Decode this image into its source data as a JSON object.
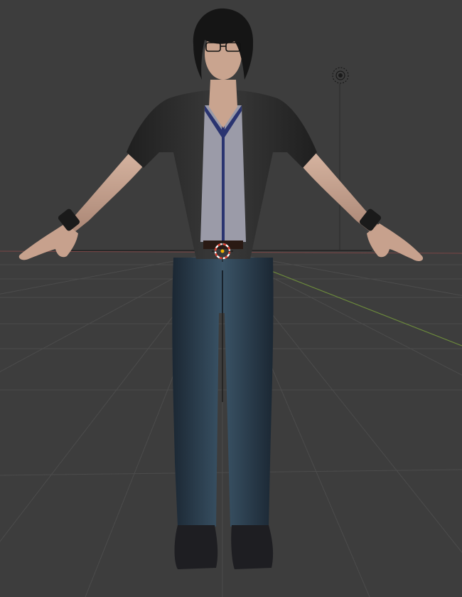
{
  "viewport": {
    "background": "#3d3d3d",
    "grid_color": "#4a4a4a",
    "x_axis_color": "#8a4a4a",
    "y_axis_color": "#6f8a3f",
    "z_axis_color": "#1c1c1c"
  },
  "scene": {
    "character": "3d-male-character-t-pose",
    "light": "sun-lamp-icon",
    "origin": "3d-cursor-icon",
    "colors": {
      "skin": "#c9a48f",
      "hair": "#151515",
      "jacket": "#2a2a2a",
      "shirt": "#9a9aa6",
      "shirt_trim": "#2a3470",
      "jeans": "#243341",
      "shoes": "#1e1e22",
      "wristband": "#1b1b1b",
      "cursor_red": "#e03a2a"
    }
  }
}
